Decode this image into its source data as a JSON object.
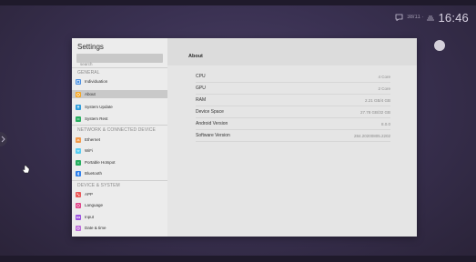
{
  "status_bar": {
    "mini_text": "38/11 ·",
    "clock": "16:46"
  },
  "settings": {
    "title": "Settings",
    "search_placeholder": "search",
    "sections": [
      {
        "label": "GENERAL",
        "items": [
          {
            "label": "Individuation",
            "icon": "individuation-icon",
            "color": "#4a90e2"
          },
          {
            "label": "About",
            "icon": "about-icon",
            "color": "#f5a623",
            "selected": true
          },
          {
            "label": "System Update",
            "icon": "system-update-icon",
            "color": "#2d9cdb"
          },
          {
            "label": "System Rest",
            "icon": "system-rest-icon",
            "color": "#27ae60"
          }
        ]
      },
      {
        "label": "NETWORK & CONNECTED DEVICE",
        "items": [
          {
            "label": "Ethernet",
            "icon": "ethernet-icon",
            "color": "#f2994a"
          },
          {
            "label": "WiFi",
            "icon": "wifi-icon",
            "color": "#56ccf2"
          },
          {
            "label": "Portable Hotspot",
            "icon": "hotspot-icon",
            "color": "#27ae60"
          },
          {
            "label": "Bluetooth",
            "icon": "bluetooth-icon",
            "color": "#2f80ed"
          }
        ]
      },
      {
        "label": "DEVICE & SYSTEM",
        "items": [
          {
            "label": "APP",
            "icon": "app-icon",
            "color": "#eb5757"
          },
          {
            "label": "Language",
            "icon": "language-icon",
            "color": "#e0458a"
          },
          {
            "label": "Input",
            "icon": "input-icon",
            "color": "#9b51e0"
          },
          {
            "label": "Date & time",
            "icon": "date-time-icon",
            "color": "#bb6bd9"
          }
        ]
      }
    ]
  },
  "about": {
    "title": "About",
    "rows": [
      {
        "key": "CPU",
        "value": "4 Core"
      },
      {
        "key": "GPU",
        "value": "2 Core"
      },
      {
        "key": "RAM",
        "value": "2.21 GB/4 GB"
      },
      {
        "key": "Device Space",
        "value": "27.78 GB/32 GB"
      },
      {
        "key": "Android Version",
        "value": "8.0.0"
      },
      {
        "key": "Software Version",
        "value": "284.20200805.2202"
      }
    ]
  }
}
